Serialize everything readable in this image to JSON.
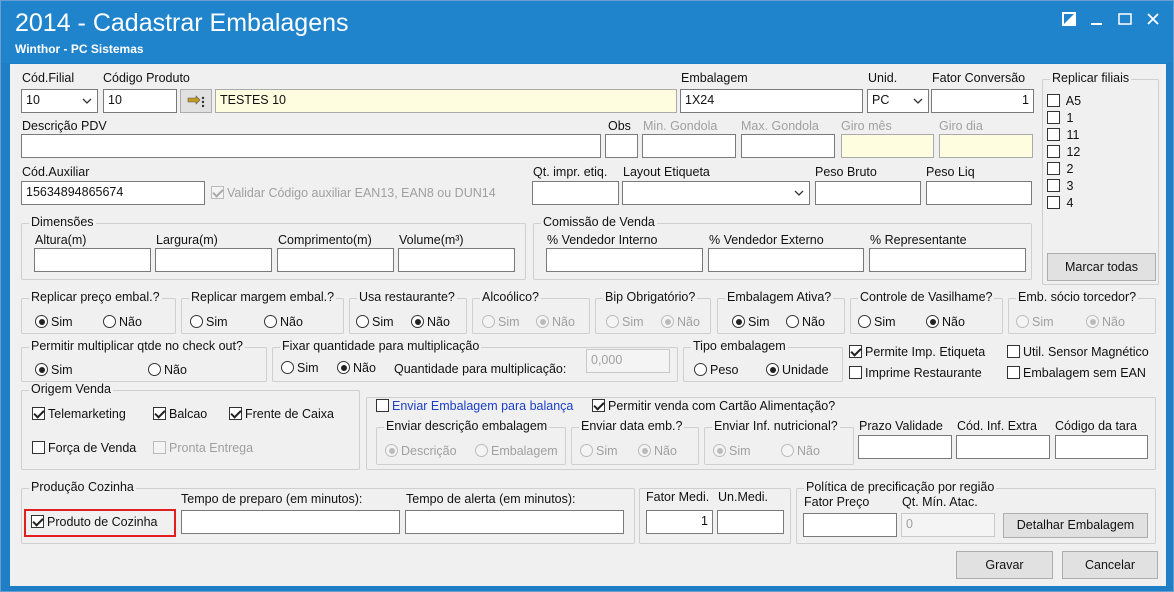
{
  "window": {
    "title": "2014 - Cadastrar Embalagens",
    "subtitle": "Winthor - PC Sistemas"
  },
  "row1": {
    "cod_filial_label": "Cód.Filial",
    "cod_filial_value": "10",
    "codigo_produto_label": "Código Produto",
    "codigo_produto_value": "10",
    "produto_descricao_value": "TESTES 10",
    "embalagem_label": "Embalagem",
    "embalagem_value": "1X24",
    "unid_label": "Unid.",
    "unid_value": "PC",
    "fator_conversao_label": "Fator Conversão",
    "fator_conversao_value": "1"
  },
  "row2": {
    "descricao_pdv_label": "Descrição PDV",
    "descricao_pdv_value": "",
    "obs_label": "Obs",
    "min_gondola_label": "Min. Gondola",
    "max_gondola_label": "Max. Gondola",
    "giro_mes_label": "Giro mês",
    "giro_dia_label": "Giro dia"
  },
  "row3": {
    "cod_auxiliar_label": "Cód.Auxiliar",
    "cod_auxiliar_value": "15634894865674",
    "validar_label": "Validar Código auxiliar EAN13, EAN8 ou DUN14",
    "qt_impr_label": "Qt. impr. etiq.",
    "layout_etiqueta_label": "Layout Etiqueta",
    "peso_bruto_label": "Peso Bruto",
    "peso_liq_label": "Peso Liq"
  },
  "replicar_filiais": {
    "title": "Replicar filiais",
    "items": [
      "A5",
      "1",
      "11",
      "12",
      "2",
      "3",
      "4"
    ],
    "marcar_todas_label": "Marcar todas"
  },
  "dimensoes": {
    "title": "Dimensões",
    "altura": "Altura(m)",
    "largura": "Largura(m)",
    "comprimento": "Comprimento(m)",
    "volume": "Volume(m³)"
  },
  "comissao": {
    "title": "Comissão de Venda",
    "vendedor_interno": "% Vendedor Interno",
    "vendedor_externo": "% Vendedor Externo",
    "representante": "% Representante"
  },
  "options": {
    "sim": "Sim",
    "nao": "Não",
    "replicar_preco": "Replicar preço embal.?",
    "replicar_margem": "Replicar margem embal.?",
    "usa_restaurante": "Usa restaurante?",
    "alcoolico": "Alcoólico?",
    "bip_obrigatorio": "Bip Obrigatório?",
    "embalagem_ativa": "Embalagem Ativa?",
    "controle_vasilhame": "Controle de Vasilhame?",
    "emb_socio_torcedor": "Emb. sócio torcedor?"
  },
  "row5": {
    "permitir_multiplicar": "Permitir multiplicar qtde no check out?",
    "fixar_quantidade": "Fixar quantidade para multiplicação",
    "quantidade_multiplicacao_label": "Quantidade para multiplicação:",
    "quantidade_multiplicacao_value": "0,000",
    "tipo_embalagem": "Tipo embalagem",
    "peso": "Peso",
    "unidade": "Unidade",
    "permite_imp_etiqueta": "Permite Imp. Etiqueta",
    "util_sensor": "Util. Sensor Magnético",
    "imprime_restaurante": "Imprime Restaurante",
    "embalagem_sem_ean": "Embalagem sem EAN"
  },
  "origem_venda": {
    "title": "Origem Venda",
    "telemarketing": "Telemarketing",
    "balcao": "Balcao",
    "frente_caixa": "Frente de Caixa",
    "forca_venda": "Força de Venda",
    "pronta_entrega": "Pronta Entrega"
  },
  "balanca": {
    "enviar_balanca": "Enviar Embalagem para balança",
    "permitir_cartao": "Permitir venda com Cartão Alimentação?",
    "enviar_descricao": "Enviar descrição embalagem",
    "descricao": "Descrição",
    "embalagem": "Embalagem",
    "enviar_data": "Enviar data emb.?",
    "enviar_inf": "Enviar Inf. nutricional?",
    "prazo_validade": "Prazo Validade",
    "cod_inf_extra": "Cód. Inf. Extra",
    "codigo_tara": "Código da tara"
  },
  "producao": {
    "title": "Produção Cozinha",
    "produto_cozinha": "Produto de Cozinha",
    "tempo_preparo": "Tempo de preparo (em minutos):",
    "tempo_alerta": "Tempo de alerta (em minutos):"
  },
  "fator": {
    "fator_medi_label": "Fator Medi.",
    "fator_medi_value": "1",
    "un_medi_label": "Un.Medi."
  },
  "politica": {
    "title": "Política de precificação por região",
    "fator_preco": "Fator Preço",
    "qt_min_atac": "Qt. Mín. Atac.",
    "qt_min_atac_value": "0",
    "detalhar_label": "Detalhar Embalagem"
  },
  "footer": {
    "gravar": "Gravar",
    "cancelar": "Cancelar"
  }
}
